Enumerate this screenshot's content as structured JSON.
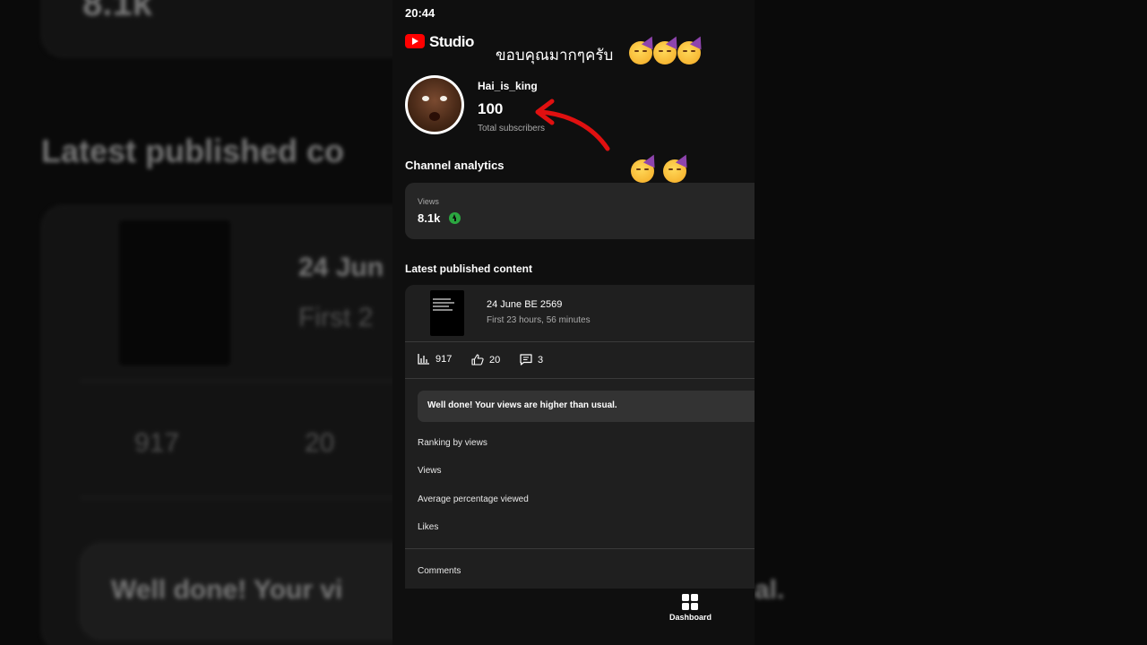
{
  "status_bar": {
    "time": "20:44"
  },
  "header": {
    "app_name": "Studio"
  },
  "channel": {
    "name": "Hai_is_king",
    "subscriber_count": "100",
    "subscriber_label": "Total subscribers"
  },
  "analytics": {
    "title": "Channel analytics",
    "views_label": "Views",
    "views_value": "8.1k",
    "trend": "up",
    "trend_color": "#2ba640"
  },
  "latest": {
    "title": "Latest published content",
    "video": {
      "title": "24 June BE 2569",
      "subtitle": "First 23 hours, 56 minutes",
      "views": "917",
      "likes": "20",
      "comments": "3"
    },
    "banner": "Well done! Your views are higher than usual.",
    "metrics": [
      "Ranking by views",
      "Views",
      "Average percentage viewed",
      "Likes",
      "Comments"
    ]
  },
  "bottom_nav": {
    "label": "Dashboard",
    "icon": "dashboard-icon"
  },
  "overlay": {
    "caption": "ขอบคุณมากๆครับ",
    "annotation_color": "#e01010",
    "emoji": "partying-face-emoji"
  },
  "background": {
    "views_value": "8.1k",
    "latest_title": "Latest published co",
    "date": "24 Jun",
    "first": "First 2",
    "views": "917",
    "likes": "20",
    "banner_start": "Well done! Your vi",
    "banner_end": "al."
  },
  "colors": {
    "brand": "#ff0000",
    "background": "#0f0f0f",
    "card": "#262626"
  }
}
